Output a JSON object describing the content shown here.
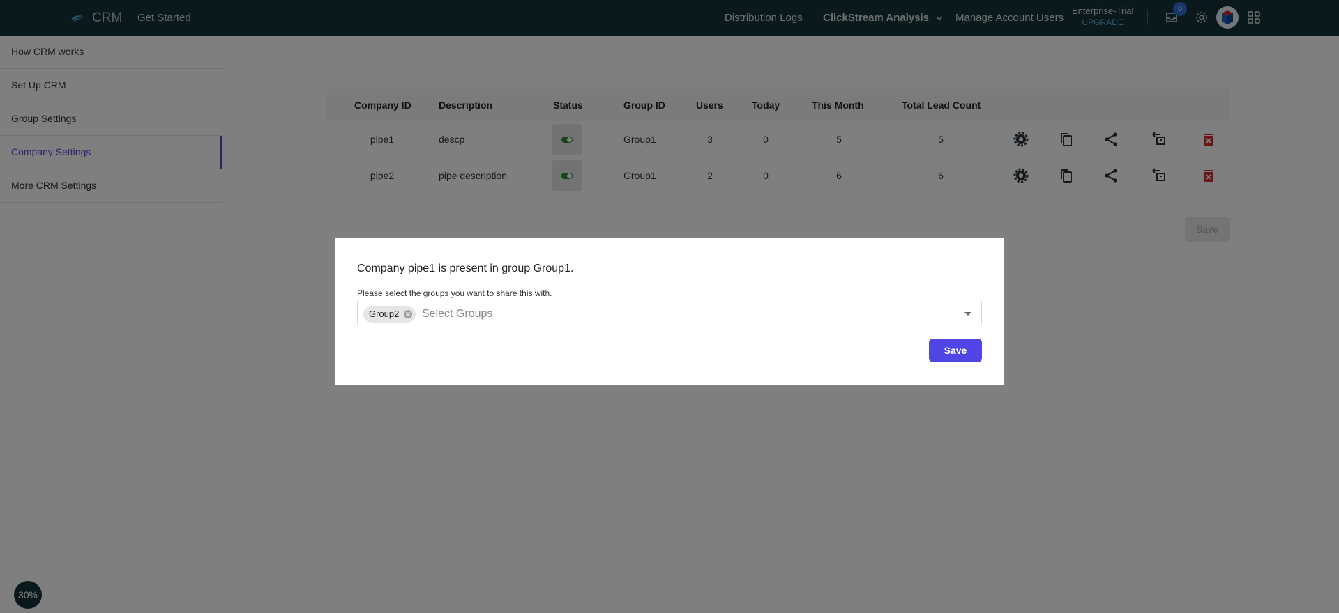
{
  "header": {
    "brand": "CRM",
    "get_started": "Get Started",
    "nav": {
      "distribution_logs": "Distribution Logs",
      "clickstream": "ClickStream Analysis",
      "manage_users": "Manage Account Users"
    },
    "plan": "Enterprise-Trial",
    "upgrade": "UPGRADE",
    "notification_count": "0"
  },
  "sidebar": {
    "items": [
      {
        "label": "How CRM works"
      },
      {
        "label": "Set Up CRM"
      },
      {
        "label": "Group Settings"
      },
      {
        "label": "Company Settings"
      },
      {
        "label": "More CRM Settings"
      }
    ],
    "progress": "30%"
  },
  "table": {
    "headers": [
      "Company ID",
      "Description",
      "Status",
      "Group ID",
      "Users",
      "Today",
      "This Month",
      "Total Lead Count"
    ],
    "rows": [
      {
        "company_id": "pipe1",
        "description": "descp",
        "group_id": "Group1",
        "users": "3",
        "today": "0",
        "this_month": "5",
        "total": "5"
      },
      {
        "company_id": "pipe2",
        "description": "pipe description",
        "group_id": "Group1",
        "users": "2",
        "today": "0",
        "this_month": "6",
        "total": "6"
      }
    ],
    "save_label": "Save"
  },
  "modal": {
    "title": "Company pipe1 is present in group Group1.",
    "hint": "Please select the groups you want to share this with.",
    "chip": "Group2",
    "placeholder": "Select Groups",
    "save_label": "Save"
  },
  "colors": {
    "topbar": "#123338",
    "accent": "#4f46e5",
    "active_sidebar": "#5b4ad6",
    "delete": "#d32f2f",
    "status_on": "#2e8b2e"
  }
}
